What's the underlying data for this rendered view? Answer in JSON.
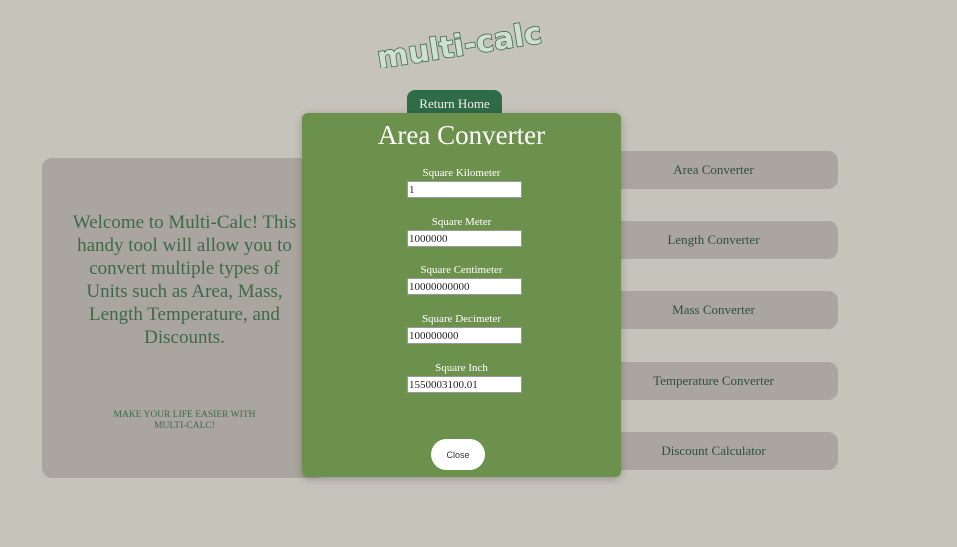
{
  "header": {
    "logo_text": "multi-calc",
    "return_home_label": "Return Home"
  },
  "welcome": {
    "message": "Welcome to Multi-Calc! This handy tool will allow you to convert multiple types of Units such as Area, Mass, Length Temperature, and Discounts.",
    "tagline": "MAKE YOUR LIFE EASIER WITH MULTI-CALC!"
  },
  "nav": {
    "items": [
      {
        "label": "Area Converter"
      },
      {
        "label": "Length Converter"
      },
      {
        "label": "Mass Converter"
      },
      {
        "label": "Temperature Converter"
      },
      {
        "label": "Discount Calculator"
      }
    ]
  },
  "modal": {
    "title": "Area Converter",
    "fields": [
      {
        "label": "Square Kilometer",
        "value": "1"
      },
      {
        "label": "Square Meter",
        "value": "1000000"
      },
      {
        "label": "Square Centimeter",
        "value": "10000000000"
      },
      {
        "label": "Square Decimeter",
        "value": "100000000"
      },
      {
        "label": "Square Inch",
        "value": "1550003100.01"
      }
    ],
    "close_label": "Close"
  },
  "colors": {
    "background": "#c6c3bb",
    "card": "#aba59f",
    "modal": "#6b914c",
    "accent_green": "#2f6b46",
    "text_green": "#3c6a48"
  }
}
